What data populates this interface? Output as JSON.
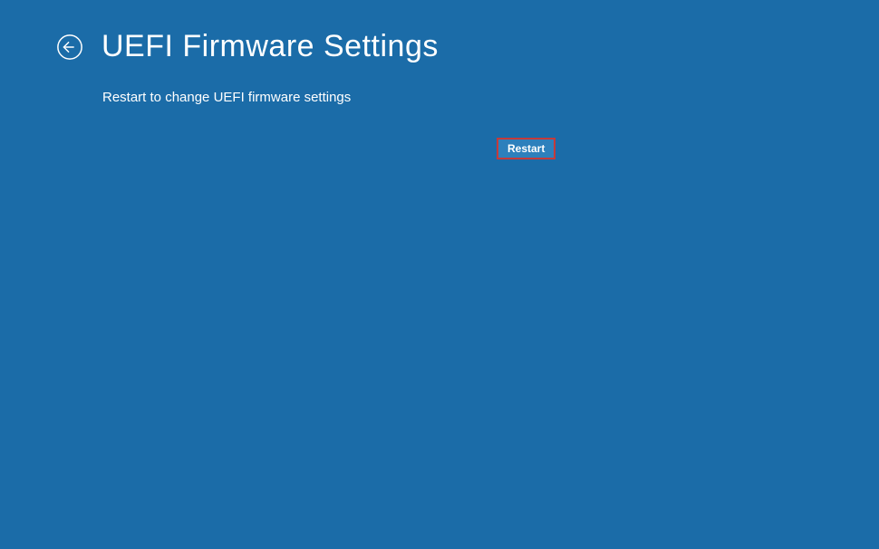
{
  "header": {
    "title": "UEFI Firmware Settings"
  },
  "description": "Restart to change UEFI firmware settings",
  "buttons": {
    "restart_label": "Restart"
  },
  "colors": {
    "background": "#1b6ca8",
    "button_bg": "#2d80bc",
    "highlight_border": "#c43a3a",
    "text": "#ffffff"
  }
}
